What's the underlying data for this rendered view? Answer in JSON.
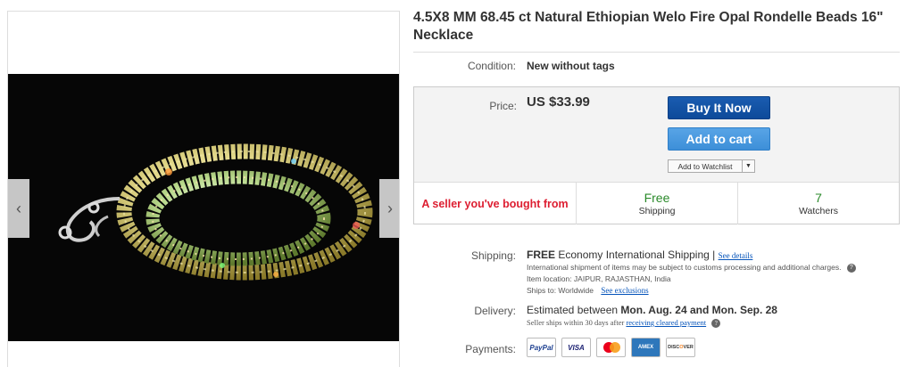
{
  "listing": {
    "title": "4.5X8 MM 68.45 ct Natural Ethiopian Welo Fire Opal Rondelle Beads 16\" Necklace"
  },
  "condition": {
    "label": "Condition:",
    "value": "New without tags"
  },
  "buybox": {
    "price_label": "Price:",
    "price_value": "US $33.99",
    "buy_now": "Buy It Now",
    "add_to_cart": "Add to cart",
    "add_to_watchlist": "Add to Watchlist"
  },
  "stats": {
    "seller": "A seller you've bought from",
    "shipping_big": "Free",
    "shipping_small": "Shipping",
    "watchers_big": "7",
    "watchers_small": "Watchers"
  },
  "shipping": {
    "label": "Shipping:",
    "free": "FREE",
    "service": "Economy International Shipping |",
    "see_details": "See details",
    "customs_note": "International shipment of items may be subject to customs processing and additional charges.",
    "item_location": "Item location:  JAIPUR, RAJASTHAN, India",
    "ships_to": "Ships to:  Worldwide",
    "see_exclusions": "See exclusions"
  },
  "delivery": {
    "label": "Delivery:",
    "prefix": "Estimated between",
    "range": "Mon. Aug. 24 and Mon. Sep. 28",
    "note": "Seller ships within 30 days after",
    "note_link": "receiving cleared payment"
  },
  "payments": {
    "label": "Payments:",
    "methods": [
      "PayPal",
      "VISA",
      "MasterCard",
      "AMEX",
      "DISCOVER"
    ]
  },
  "gallery": {
    "prev_icon": "chevron-left-icon",
    "next_icon": "chevron-right-icon"
  },
  "colors": {
    "buy_now": "#0d4a9a",
    "add_to_cart": "#3d8fd8",
    "seller_red": "#dd1e31",
    "free_green": "#2a8a2a",
    "link_blue": "#0654ba"
  }
}
